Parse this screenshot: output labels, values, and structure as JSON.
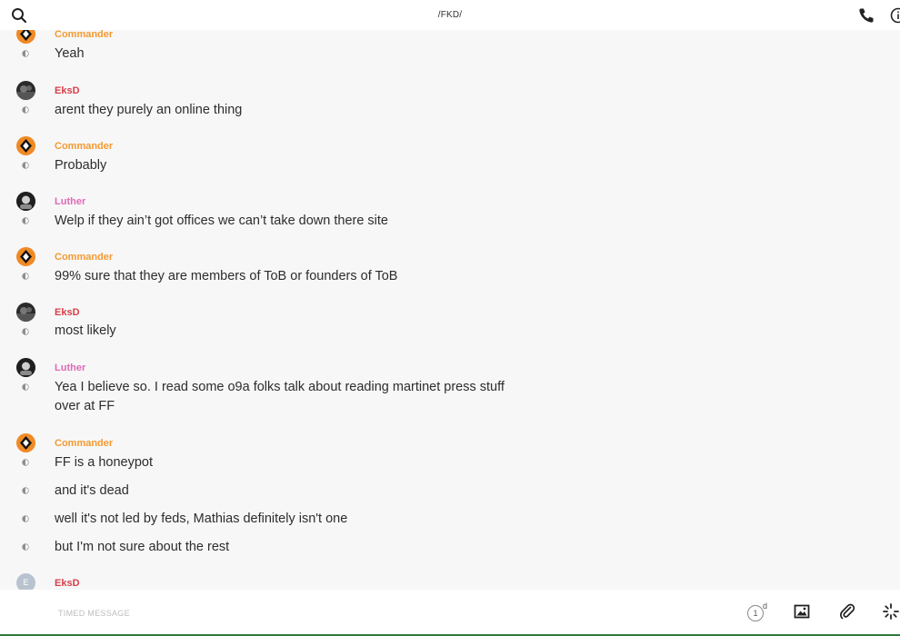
{
  "header": {
    "title": "/FKD/"
  },
  "messages": [
    {
      "author": "Commander",
      "avatar": "commander",
      "lines": [
        "Yeah"
      ]
    },
    {
      "author": "EksD",
      "avatar": "dark",
      "lines": [
        "arent they purely an online thing"
      ]
    },
    {
      "author": "Commander",
      "avatar": "commander",
      "lines": [
        "Probably"
      ]
    },
    {
      "author": "Luther",
      "avatar": "dark",
      "lines": [
        "Welp if they ain’t got offices we can’t take down there site"
      ]
    },
    {
      "author": "Commander",
      "avatar": "commander",
      "lines": [
        "99% sure that they are members of ToB or founders of ToB"
      ]
    },
    {
      "author": "EksD",
      "avatar": "dark",
      "lines": [
        "most likely"
      ]
    },
    {
      "author": "Luther",
      "avatar": "dark",
      "lines": [
        "Yea I believe so. I read some o9a folks talk about reading martinet press stuff over at FF"
      ]
    },
    {
      "author": "Commander",
      "avatar": "commander",
      "lines": [
        "FF is a honeypot",
        "and it's dead",
        "well it's not led by feds, Mathias definitely isn't one",
        "but I'm not sure about the rest"
      ]
    },
    {
      "author": "EksD",
      "avatar": "letter",
      "avatar_letter": "E",
      "lines": []
    }
  ],
  "composer": {
    "placeholder": "TIMED MESSAGE",
    "timer_value": "1",
    "timer_unit": "d"
  },
  "icons": {
    "search": "search-icon",
    "phone": "phone-icon",
    "info": "info-icon",
    "image": "image-icon",
    "attach": "paperclip-icon",
    "spinner": "loading-spinner-icon"
  },
  "colors": {
    "commander": "#f39a32",
    "eksd": "#d8404a",
    "luther": "#e06bb6",
    "background": "#f7f7f8"
  }
}
